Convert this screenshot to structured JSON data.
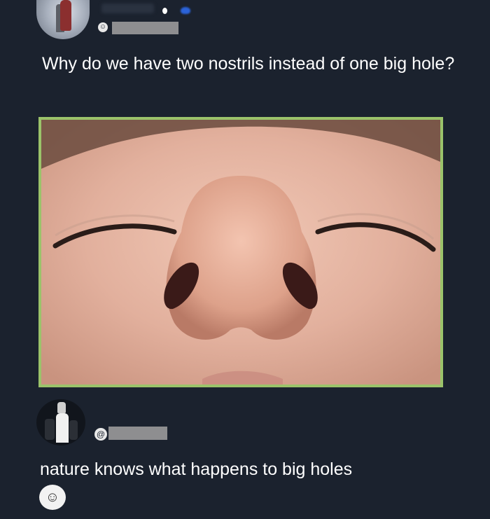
{
  "post": {
    "text": "Why do we have two nostrils instead of one big hole?",
    "handle_icon": "☺"
  },
  "image": {
    "subject": "nose-closeup-photo"
  },
  "reply": {
    "handle_prefix": "@",
    "text": "nature knows what happens to big holes",
    "emoji": "☺"
  },
  "colors": {
    "background": "#1b222e",
    "text": "#ffffff",
    "image_border": "#9bc36a",
    "redaction": "#8e8e90"
  }
}
